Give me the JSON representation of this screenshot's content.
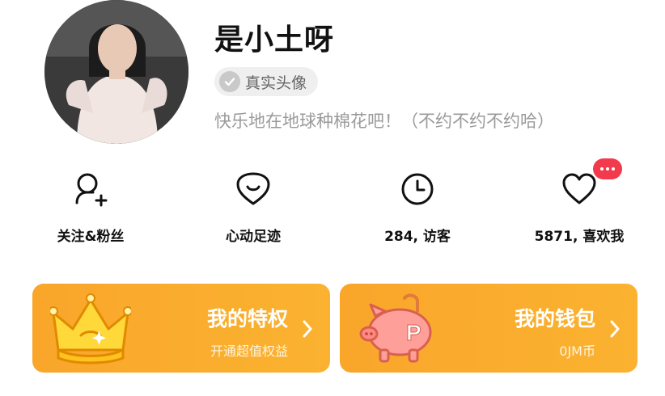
{
  "profile": {
    "username": "是小土呀",
    "verify_label": "真实头像",
    "bio": "快乐地在地球种棉花吧！（不约不约不约哈）",
    "avatar_icon": "profile-photo"
  },
  "stats": [
    {
      "icon": "follow-user-plus-icon",
      "label": "关注&粉丝"
    },
    {
      "icon": "smile-heart-icon",
      "label": "心动足迹"
    },
    {
      "icon": "clock-icon",
      "label": "284, 访客"
    },
    {
      "icon": "heart-icon",
      "label": "5871, 喜欢我"
    }
  ],
  "notification": {
    "icon": "more-dots-badge",
    "color": "#f23a4c"
  },
  "cards": {
    "privileges": {
      "title": "我的特权",
      "subtitle": "开通超值权益",
      "icon": "crown-icon"
    },
    "wallet": {
      "title": "我的钱包",
      "subtitle": "0JM币",
      "icon": "piggy-bank-icon"
    }
  },
  "colors": {
    "accent": "#f9a62b",
    "badge": "#f23a4c",
    "muted_text": "#9a9a9a"
  }
}
